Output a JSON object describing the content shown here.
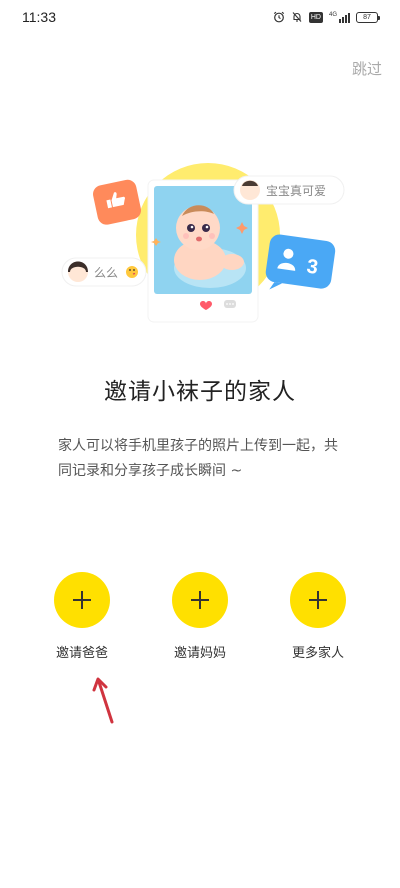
{
  "status_bar": {
    "time": "11:33",
    "battery": "87",
    "hd": "HD",
    "signal_label": "4G"
  },
  "skip_label": "跳过",
  "illustration": {
    "comment_top": "宝宝真可爱",
    "comment_left": "么么",
    "count_badge": "3"
  },
  "title": "邀请小袜子的家人",
  "description": "家人可以将手机里孩子的照片上传到一起，共同记录和分享孩子成长瞬间 ~",
  "invites": [
    {
      "label": "邀请爸爸"
    },
    {
      "label": "邀请妈妈"
    },
    {
      "label": "更多家人"
    }
  ],
  "colors": {
    "accent": "#ffe000",
    "annotation_arrow": "#d0343f"
  }
}
